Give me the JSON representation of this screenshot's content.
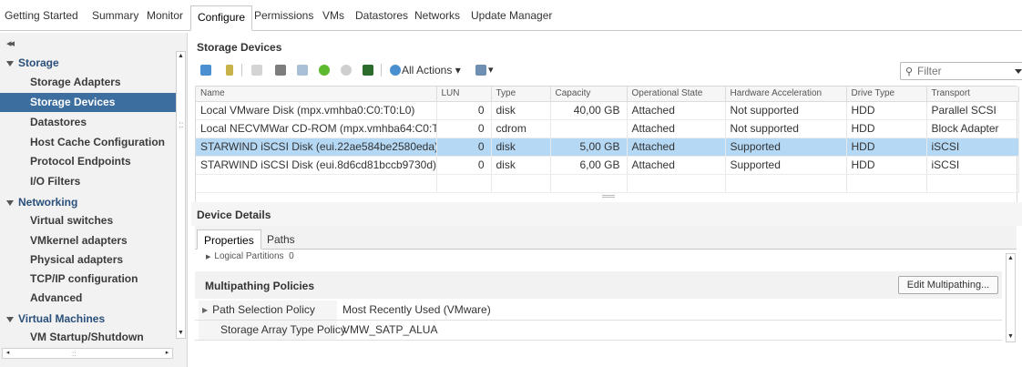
{
  "top_tabs": [
    {
      "label": "Getting Started"
    },
    {
      "label": "Summary"
    },
    {
      "label": "Monitor"
    },
    {
      "label": "Configure"
    },
    {
      "label": "Permissions"
    },
    {
      "label": "VMs"
    },
    {
      "label": "Datastores"
    },
    {
      "label": "Networks"
    },
    {
      "label": "Update Manager"
    }
  ],
  "sidebar": {
    "collapse_icon": "double-chevron-left-icon",
    "groups": [
      {
        "label": "Storage",
        "items": [
          "Storage Adapters",
          "Storage Devices",
          "Datastores",
          "Host Cache Configuration",
          "Protocol Endpoints",
          "I/O Filters"
        ]
      },
      {
        "label": "Networking",
        "items": [
          "Virtual switches",
          "VMkernel adapters",
          "Physical adapters",
          "TCP/IP configuration",
          "Advanced"
        ]
      },
      {
        "label": "Virtual Machines",
        "items": [
          "VM Startup/Shutdown"
        ]
      }
    ],
    "selected_item": "Storage Devices"
  },
  "main": {
    "title": "Storage Devices",
    "toolbar": {
      "icons": [
        "rescan-storage-icon",
        "attach-device-icon",
        "detach-device-icon",
        "disk-icon",
        "rename-icon",
        "turn-on-led-icon",
        "turn-off-led-icon",
        "flash-disk-icon"
      ],
      "all_actions_label": "All Actions",
      "filter_placeholder": "Filter"
    },
    "table": {
      "columns": [
        "Name",
        "LUN",
        "Type",
        "Capacity",
        "Operational State",
        "Hardware Acceleration",
        "Drive Type",
        "Transport"
      ],
      "rows": [
        [
          "Local VMware Disk (mpx.vmhba0:C0:T0:L0)",
          "0",
          "disk",
          "40,00 GB",
          "Attached",
          "Not supported",
          "HDD",
          "Parallel SCSI"
        ],
        [
          "Local NECVMWar CD-ROM (mpx.vmhba64:C0:T0...",
          "0",
          "cdrom",
          "",
          "Attached",
          "Not supported",
          "HDD",
          "Block Adapter"
        ],
        [
          "STARWIND iSCSI Disk (eui.22ae584be2580eda)",
          "0",
          "disk",
          "5,00 GB",
          "Attached",
          "Supported",
          "HDD",
          "iSCSI"
        ],
        [
          "STARWIND iSCSI Disk (eui.8d6cd81bccb9730d)",
          "0",
          "disk",
          "6,00 GB",
          "Attached",
          "Supported",
          "HDD",
          "iSCSI"
        ]
      ],
      "selected_row_index": 2
    },
    "device_details": {
      "title": "Device Details",
      "tabs": [
        "Properties",
        "Paths"
      ],
      "active_tab": "Properties",
      "logical_partitions_label": "Logical Partitions",
      "logical_partitions_value": "0",
      "multipathing_title": "Multipathing Policies",
      "edit_button_label": "Edit Multipathing...",
      "policies": [
        {
          "key": "Path Selection Policy",
          "value": "Most Recently Used (VMware)"
        },
        {
          "key": "Storage Array Type Policy",
          "value": "VMW_SATP_ALUA"
        }
      ]
    }
  },
  "colors": {
    "selected_nav": "#3c6e9f",
    "selected_row": "#b5d8f5",
    "group_label": "#2a4f7a"
  }
}
